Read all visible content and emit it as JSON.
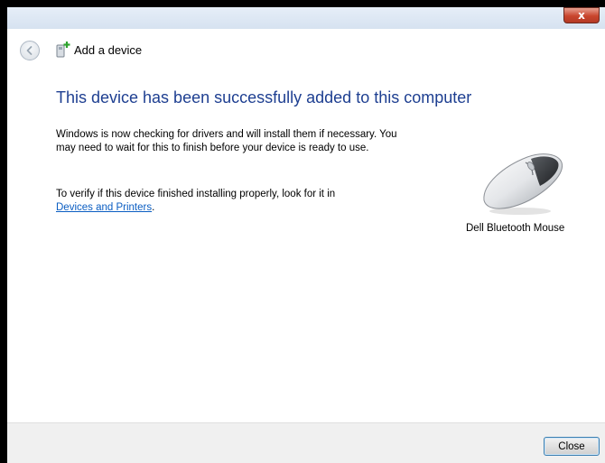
{
  "window": {
    "close_glyph": "x"
  },
  "nav": {
    "title": "Add a device",
    "back_icon": "back-arrow-icon",
    "device_icon": "add-device-icon"
  },
  "content": {
    "heading": "This device has been successfully added to this computer",
    "para1": "Windows is now checking for drivers and will install them if necessary. You may need to wait for this to finish before your device is ready to use.",
    "para2_prefix": "To verify if this device finished installing properly, look for it in",
    "para2_link": "Devices and Printers",
    "para2_suffix": ".",
    "device_name": "Dell Bluetooth Mouse",
    "device_image": "mouse-icon"
  },
  "footer": {
    "close_label": "Close"
  },
  "colors": {
    "heading": "#1e3f91",
    "link": "#0a5dc2",
    "close_button": "#c9452d"
  }
}
